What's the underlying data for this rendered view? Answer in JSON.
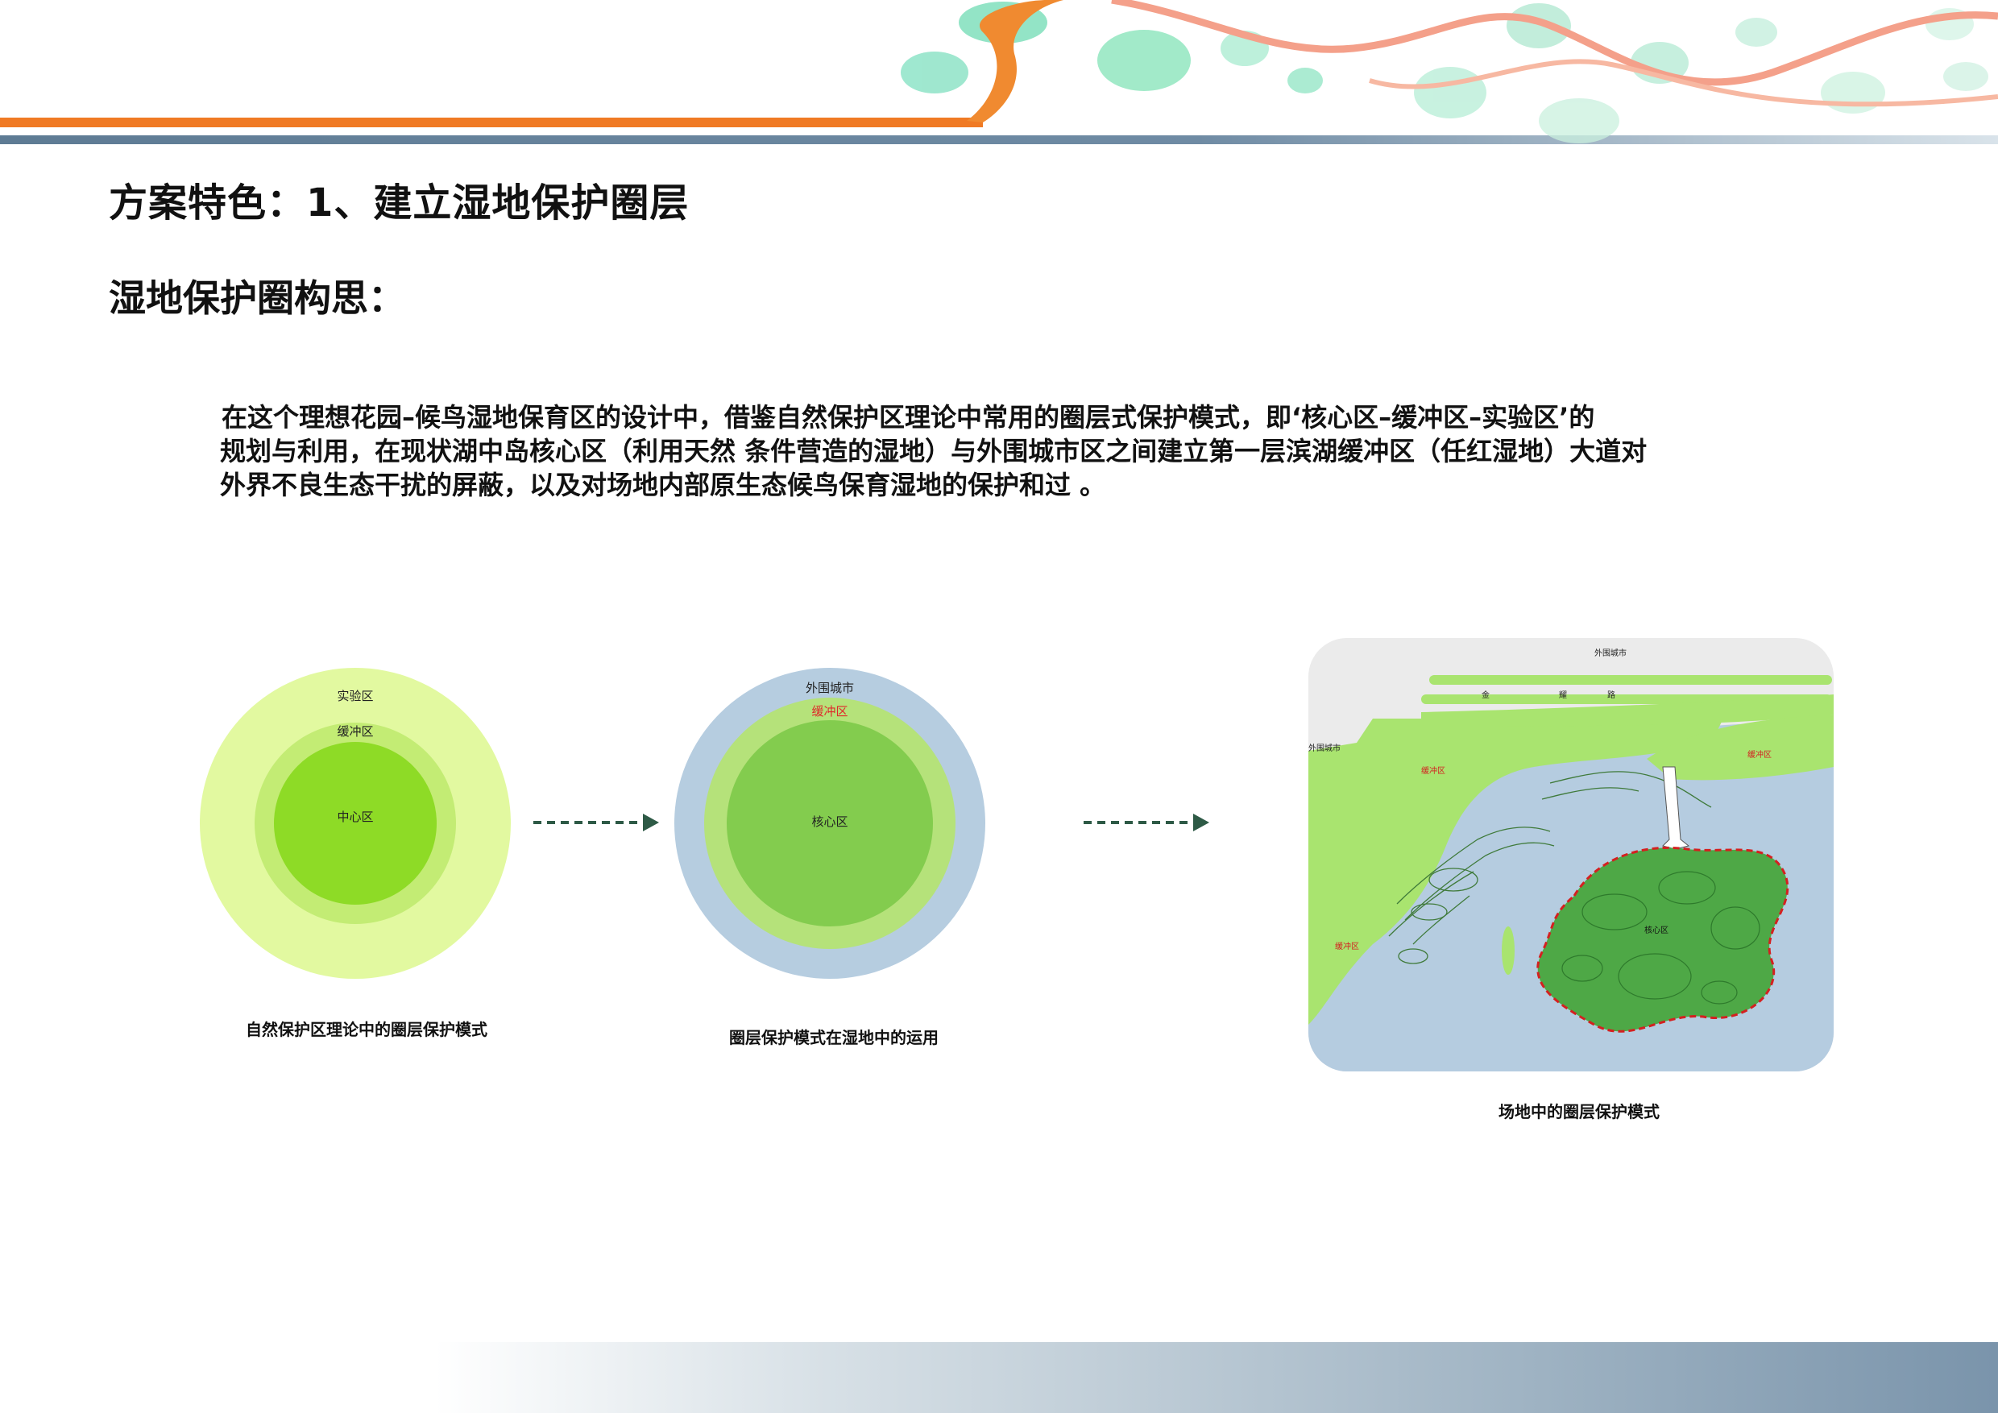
{
  "header": {
    "title": "方案特色：1、建立湿地保护圈层",
    "subtitle": "湿地保护圈构思："
  },
  "paragraph": {
    "lines": [
      "在这个理想花园–候鸟湿地保育区的设计中，借鉴自然保护区理论中常用的圈层式保护模式，即‘核心区–缓冲区–实验区’的",
      "规划与利用，在现状湖中岛核心区（利用天然 条件营造的湿地）与外围城市区之间建立第一层滨湖缓冲区（任红湿地）大道对",
      "外界不良生态干扰的屏蔽，以及对场地内部原生态候鸟保育湿地的保护和过 。"
    ]
  },
  "diagram1": {
    "outer_label": "实验区",
    "middle_label": "缓冲区",
    "inner_label": "中心区",
    "caption": "自然保护区理论中的圈层保护模式",
    "colors": {
      "outer": "#e2f9a0",
      "middle": "#c3ec74",
      "inner": "#8edb26"
    }
  },
  "diagram2": {
    "outer_label": "外围城市",
    "middle_label": "缓冲区",
    "inner_label": "核心区",
    "caption": "圈层保护模式在湿地中的运用",
    "colors": {
      "outer": "#b6cde0",
      "middle": "#b5e27a",
      "inner": "#83cc4e",
      "middle_label_color": "#e0282a"
    }
  },
  "diagram3": {
    "top_label": "外围城市",
    "left_label": "外围城市",
    "road_chars": [
      "金",
      "耀",
      "路"
    ],
    "buffer_labels": [
      "缓冲区",
      "缓冲区",
      "缓冲区"
    ],
    "core_label": "核心区",
    "caption": "场地中的圈层保护模式",
    "colors": {
      "water": "#b5cce0",
      "land": "#a9e46f",
      "core": "#4ea846",
      "boundary": "#d42020"
    }
  },
  "arrow_color": "#2e5a46"
}
